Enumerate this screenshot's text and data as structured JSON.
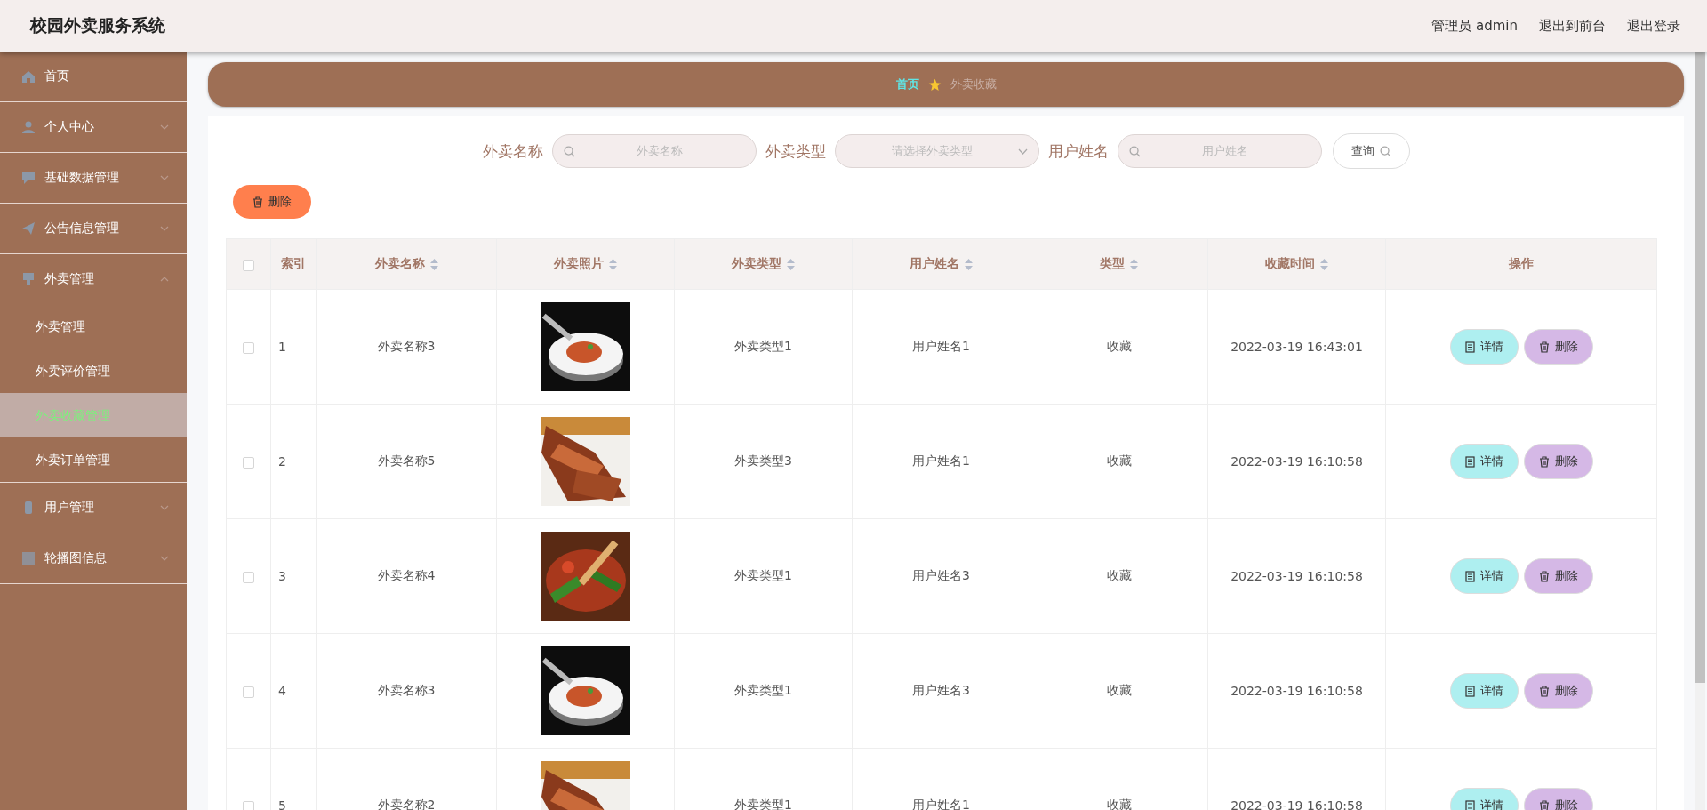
{
  "header": {
    "title": "校园外卖服务系统",
    "links": [
      "管理员 admin",
      "退出到前台",
      "退出登录"
    ]
  },
  "sidebar": {
    "items": [
      {
        "label": "首页",
        "kind": "link"
      },
      {
        "label": "个人中心",
        "kind": "group",
        "expanded": false
      },
      {
        "label": "基础数据管理",
        "kind": "group",
        "expanded": false
      },
      {
        "label": "公告信息管理",
        "kind": "group",
        "expanded": false
      },
      {
        "label": "外卖管理",
        "kind": "group",
        "expanded": true,
        "children": [
          {
            "label": "外卖管理",
            "selected": false
          },
          {
            "label": "外卖评价管理",
            "selected": false
          },
          {
            "label": "外卖收藏管理",
            "selected": true
          },
          {
            "label": "外卖订单管理",
            "selected": false
          }
        ]
      },
      {
        "label": "用户管理",
        "kind": "group",
        "expanded": false
      },
      {
        "label": "轮播图信息",
        "kind": "group",
        "expanded": false
      }
    ]
  },
  "breadcrumb": [
    "首页",
    "外卖收藏"
  ],
  "search": {
    "fields": [
      {
        "label": "外卖名称",
        "kind": "input",
        "placeholder": "外卖名称"
      },
      {
        "label": "外卖类型",
        "kind": "select",
        "placeholder": "请选择外卖类型"
      },
      {
        "label": "用户姓名",
        "kind": "input",
        "placeholder": "用户姓名"
      }
    ],
    "button": "查询"
  },
  "bulk_delete": "删除",
  "table": {
    "header_checked": false,
    "columns": [
      {
        "label": "索引",
        "sortable": false
      },
      {
        "label": "外卖名称",
        "sortable": true
      },
      {
        "label": "外卖照片",
        "sortable": true
      },
      {
        "label": "外卖类型",
        "sortable": true
      },
      {
        "label": "用户姓名",
        "sortable": true
      },
      {
        "label": "类型",
        "sortable": true
      },
      {
        "label": "收藏时间",
        "sortable": true
      },
      {
        "label": "操作",
        "sortable": false
      }
    ],
    "rows": [
      {
        "checked": false,
        "index": "1",
        "name": "外卖名称3",
        "photo": {
          "kind": "picture"
        },
        "type": "外卖类型1",
        "user": "用户姓名1",
        "kind": "收藏",
        "time": "2022-03-19 16:43:01",
        "actions": [
          "详情",
          "删除"
        ]
      },
      {
        "checked": false,
        "index": "2",
        "name": "外卖名称5",
        "photo": {
          "kind": "picture"
        },
        "type": "外卖类型3",
        "user": "用户姓名1",
        "kind": "收藏",
        "time": "2022-03-19 16:10:58",
        "actions": [
          "详情",
          "删除"
        ]
      },
      {
        "checked": false,
        "index": "3",
        "name": "外卖名称4",
        "photo": {
          "kind": "picture"
        },
        "type": "外卖类型1",
        "user": "用户姓名3",
        "kind": "收藏",
        "time": "2022-03-19 16:10:58",
        "actions": [
          "详情",
          "删除"
        ]
      },
      {
        "checked": false,
        "index": "4",
        "name": "外卖名称3",
        "photo": {
          "kind": "picture"
        },
        "type": "外卖类型1",
        "user": "用户姓名3",
        "kind": "收藏",
        "time": "2022-03-19 16:10:58",
        "actions": [
          "详情",
          "删除"
        ]
      },
      {
        "checked": false,
        "index": "5",
        "name": "外卖名称2",
        "photo": {
          "kind": "picture"
        },
        "type": "外卖类型1",
        "user": "用户姓名1",
        "kind": "收藏",
        "time": "2022-03-19 16:10:58",
        "actions": [
          "详情",
          "删除"
        ]
      }
    ]
  }
}
